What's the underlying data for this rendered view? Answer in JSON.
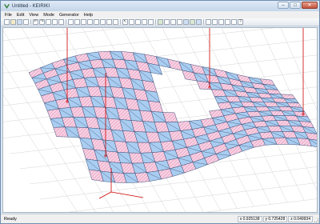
{
  "window": {
    "title": "Untitled - KEIRIKI",
    "controls": [
      {
        "name": "minimize-button",
        "glyph": "–"
      },
      {
        "name": "maximize-button",
        "glyph": "□"
      },
      {
        "name": "close-button",
        "glyph": "✕"
      }
    ]
  },
  "menu": [
    "File",
    "Edit",
    "View",
    "Mode",
    "Generator",
    "Help"
  ],
  "toolbar": {
    "buttons": [
      {
        "icon": "new-file-icon",
        "glyph": "",
        "tone": ""
      },
      {
        "icon": "open-folder-icon",
        "glyph": "",
        "tone": "y"
      },
      {
        "icon": "save-icon",
        "glyph": "",
        "tone": "b"
      },
      {
        "icon": "print-icon",
        "glyph": "",
        "tone": ""
      },
      {
        "icon": "undo-icon",
        "glyph": "↶",
        "tone": ""
      },
      {
        "icon": "redo-icon",
        "glyph": "↷",
        "tone": ""
      },
      {
        "icon": "cut-icon",
        "glyph": "",
        "tone": ""
      },
      {
        "icon": "copy-icon",
        "glyph": "",
        "tone": ""
      },
      {
        "icon": "paste-icon",
        "glyph": "",
        "tone": ""
      },
      {
        "icon": "zoom-icon",
        "glyph": "",
        "tone": ""
      },
      {
        "icon": "pan-icon",
        "glyph": "",
        "tone": ""
      },
      {
        "icon": "rotate-icon",
        "glyph": "",
        "tone": ""
      },
      {
        "icon": "fit-view-icon",
        "glyph": "",
        "tone": ""
      },
      {
        "icon": "front-view-icon",
        "glyph": "",
        "tone": ""
      },
      {
        "icon": "top-view-icon",
        "glyph": "",
        "tone": ""
      },
      {
        "icon": "side-view-icon",
        "glyph": "",
        "tone": ""
      },
      {
        "icon": "perspective-icon",
        "glyph": "",
        "tone": ""
      },
      {
        "icon": "select-icon",
        "glyph": "↖",
        "tone": ""
      },
      {
        "icon": "node-icon",
        "glyph": "",
        "tone": ""
      },
      {
        "icon": "member-icon",
        "glyph": "",
        "tone": ""
      },
      {
        "icon": "support-icon",
        "glyph": "",
        "tone": ""
      },
      {
        "icon": "load-icon",
        "glyph": "",
        "tone": ""
      },
      {
        "icon": "analysis-icon",
        "glyph": "",
        "tone": "g"
      },
      {
        "icon": "moment-icon",
        "glyph": "",
        "tone": ""
      },
      {
        "icon": "shear-icon",
        "glyph": "",
        "tone": ""
      },
      {
        "icon": "axial-icon",
        "glyph": "",
        "tone": ""
      },
      {
        "icon": "deform-icon",
        "glyph": "",
        "tone": "b"
      },
      {
        "icon": "stress-color-icon",
        "glyph": "",
        "tone": "g"
      },
      {
        "icon": "render-icon",
        "glyph": "",
        "tone": "b"
      },
      {
        "icon": "settings-icon",
        "glyph": "",
        "tone": ""
      },
      {
        "icon": "grid-icon",
        "glyph": "",
        "tone": ""
      },
      {
        "icon": "axis-icon",
        "glyph": "",
        "tone": ""
      },
      {
        "icon": "label-icon",
        "glyph": "",
        "tone": ""
      },
      {
        "icon": "filter-icon",
        "glyph": "",
        "tone": ""
      },
      {
        "icon": "help-icon",
        "glyph": "?",
        "tone": ""
      }
    ]
  },
  "status": {
    "text": "Ready",
    "coords": [
      "x 0.925138",
      "y 0.725428",
      "z 0.049934"
    ]
  },
  "colors": {
    "tile_blue": "#a9cdf0",
    "tile_pink": "#f7d2e4",
    "edge": "#3a4f7a",
    "hatch": "#c2185b",
    "load_line": "#cc0000",
    "axis_line": "#cc0000"
  }
}
